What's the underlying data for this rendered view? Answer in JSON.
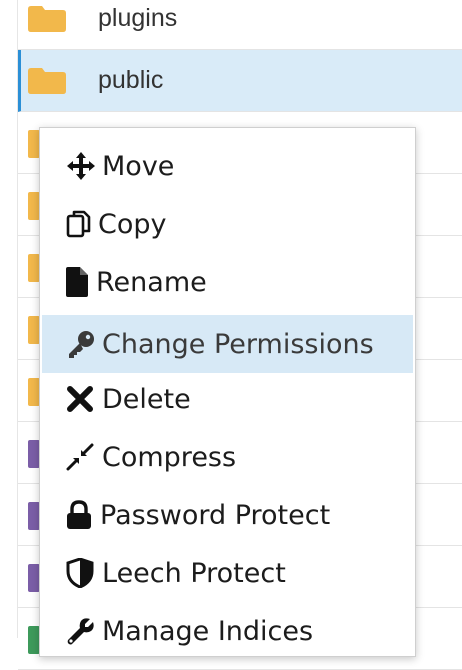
{
  "files": [
    {
      "name": "plugins",
      "icon": "folder-icon",
      "selected": false
    },
    {
      "name": "public",
      "icon": "folder-icon",
      "selected": true
    }
  ],
  "context_menu": {
    "items": [
      {
        "label": "Move",
        "icon": "move-icon"
      },
      {
        "label": "Copy",
        "icon": "copy-icon"
      },
      {
        "label": "Rename",
        "icon": "file-icon"
      },
      {
        "label": "Change Permissions",
        "icon": "key-icon",
        "highlighted": true
      },
      {
        "label": "Delete",
        "icon": "close-icon"
      },
      {
        "label": "Compress",
        "icon": "compress-icon"
      },
      {
        "label": "Password Protect",
        "icon": "lock-icon"
      },
      {
        "label": "Leech Protect",
        "icon": "shield-icon"
      },
      {
        "label": "Manage Indices",
        "icon": "wrench-icon"
      }
    ]
  },
  "colors": {
    "folder": "#f2b84b",
    "selected_row": "#d9ebf8",
    "selected_accent": "#2b8fd6",
    "menu_highlight": "#d7e9f6",
    "file_icon_purple": "#7b5ea7",
    "file_icon_green": "#3d9a5b"
  }
}
